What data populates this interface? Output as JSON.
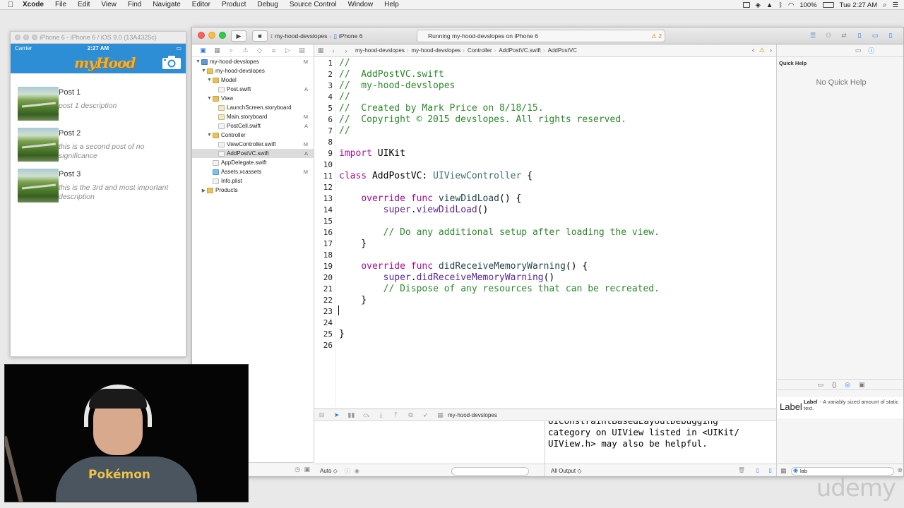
{
  "menubar": {
    "app": "Xcode",
    "items": [
      "File",
      "Edit",
      "View",
      "Find",
      "Navigate",
      "Editor",
      "Product",
      "Debug",
      "Source Control",
      "Window",
      "Help"
    ],
    "battery": "100%",
    "clock": "Tue 2:27 AM"
  },
  "simulator": {
    "title": "iPhone 6 - iPhone 6 / iOS 9.0 (13A4325c)",
    "carrier": "Carrier",
    "time": "2:27 AM",
    "logo": "myHood",
    "posts": [
      {
        "title": "Post 1",
        "desc": "post 1 description"
      },
      {
        "title": "Post 2",
        "desc": "this is a second post of no significance"
      },
      {
        "title": "Post 3",
        "desc": "this is the 3rd and most important description"
      }
    ]
  },
  "xcode": {
    "scheme": "my-hood-devslopes",
    "device": "iPhone 6",
    "activity": "Running my-hood-devslopes on iPhone 6",
    "warnings": "2",
    "navigator": {
      "rows": [
        {
          "label": "my-hood-devslopes",
          "badge": "M"
        },
        {
          "label": "my-hood-devslopes",
          "badge": ""
        },
        {
          "label": "Model",
          "badge": ""
        },
        {
          "label": "Post.swift",
          "badge": "A"
        },
        {
          "label": "View",
          "badge": ""
        },
        {
          "label": "LaunchScreen.storyboard",
          "badge": ""
        },
        {
          "label": "Main.storyboard",
          "badge": "M"
        },
        {
          "label": "PostCell.swift",
          "badge": "A"
        },
        {
          "label": "Controller",
          "badge": ""
        },
        {
          "label": "ViewController.swift",
          "badge": "M"
        },
        {
          "label": "AddPostVC.swift",
          "badge": "A"
        },
        {
          "label": "AppDelegate.swift",
          "badge": ""
        },
        {
          "label": "Assets.xcassets",
          "badge": "M"
        },
        {
          "label": "Info.plist",
          "badge": ""
        },
        {
          "label": "Products",
          "badge": ""
        }
      ]
    },
    "jumpbar": [
      "my-hood-devslopes",
      "my-hood-devslopes",
      "Controller",
      "AddPostVC.swift",
      "AddPostVC"
    ],
    "code_lines": [
      "//",
      "//  AddPostVC.swift",
      "//  my-hood-devslopes",
      "//",
      "//  Created by Mark Price on 8/18/15.",
      "//  Copyright © 2015 devslopes. All rights reserved.",
      "//",
      "",
      "import UIKit",
      "",
      "class AddPostVC: UIViewController {",
      "",
      "    override func viewDidLoad() {",
      "        super.viewDidLoad()",
      "",
      "        // Do any additional setup after loading the view.",
      "    }",
      "",
      "    override func didReceiveMemoryWarning() {",
      "        super.didReceiveMemoryWarning()",
      "        // Dispose of any resources that can be recreated.",
      "    }",
      "",
      "",
      "}",
      ""
    ],
    "debug": {
      "target": "my-hood-devslopes",
      "console_lines": [
        "UIConstraintBasedLayoutDebugging",
        "category on UIView listed in <UIKit/",
        "UIView.h> may also be helpful."
      ],
      "auto_label": "Auto ◇",
      "output_label": "All Output ◇"
    },
    "utilities": {
      "quick_help_title": "Quick Help",
      "no_quick_help": "No Quick Help",
      "library_item_big": "Label",
      "library_item_name": "Label",
      "library_item_desc": "- A variably sized amount of static text.",
      "filter_value": "lab"
    }
  },
  "watermark": "udemy",
  "webcam_shirt": "Pokémon",
  "colors": {
    "accent": "#2d79e0",
    "ios_nav": "#2d8ed6",
    "comment": "#2a8a2a",
    "keyword": "#aa0d91"
  }
}
